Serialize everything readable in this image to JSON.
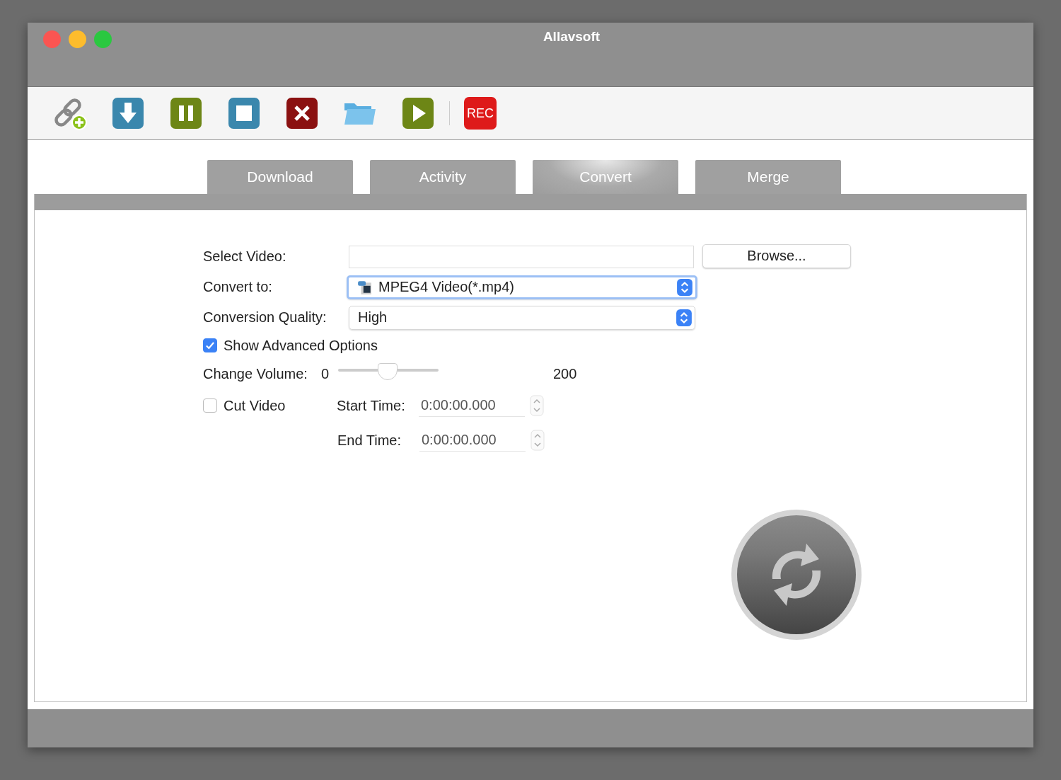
{
  "window": {
    "title": "Allavsoft"
  },
  "toolbar": [
    {
      "kind": "link-add"
    },
    {
      "kind": "download"
    },
    {
      "kind": "pause"
    },
    {
      "kind": "stop"
    },
    {
      "kind": "delete"
    },
    {
      "kind": "folder"
    },
    {
      "kind": "play"
    },
    {
      "kind": "separator"
    },
    {
      "kind": "record",
      "label": "REC"
    }
  ],
  "tabs": [
    {
      "label": "Download",
      "selected": false
    },
    {
      "label": "Activity",
      "selected": false
    },
    {
      "label": "Convert",
      "selected": true
    },
    {
      "label": "Merge",
      "selected": false
    }
  ],
  "form": {
    "select_video": {
      "label": "Select Video:",
      "browse": "Browse..."
    },
    "convert_to": {
      "label": "Convert to:",
      "value": "MPEG4 Video(*.mp4)",
      "focused": true
    },
    "quality": {
      "label": "Conversion Quality:",
      "value": "High"
    },
    "advanced": {
      "label": "Show Advanced Options",
      "checked": true
    },
    "volume": {
      "label": "Change Volume:",
      "min": "0",
      "max": "200",
      "level": 0.49
    },
    "cut_video": {
      "label": "Cut Video",
      "checked": false
    },
    "start_time": {
      "label": "Start Time:",
      "value": "0:00:00.000"
    },
    "end_time": {
      "label": "End Time:",
      "value": "0:00:00.000"
    }
  }
}
